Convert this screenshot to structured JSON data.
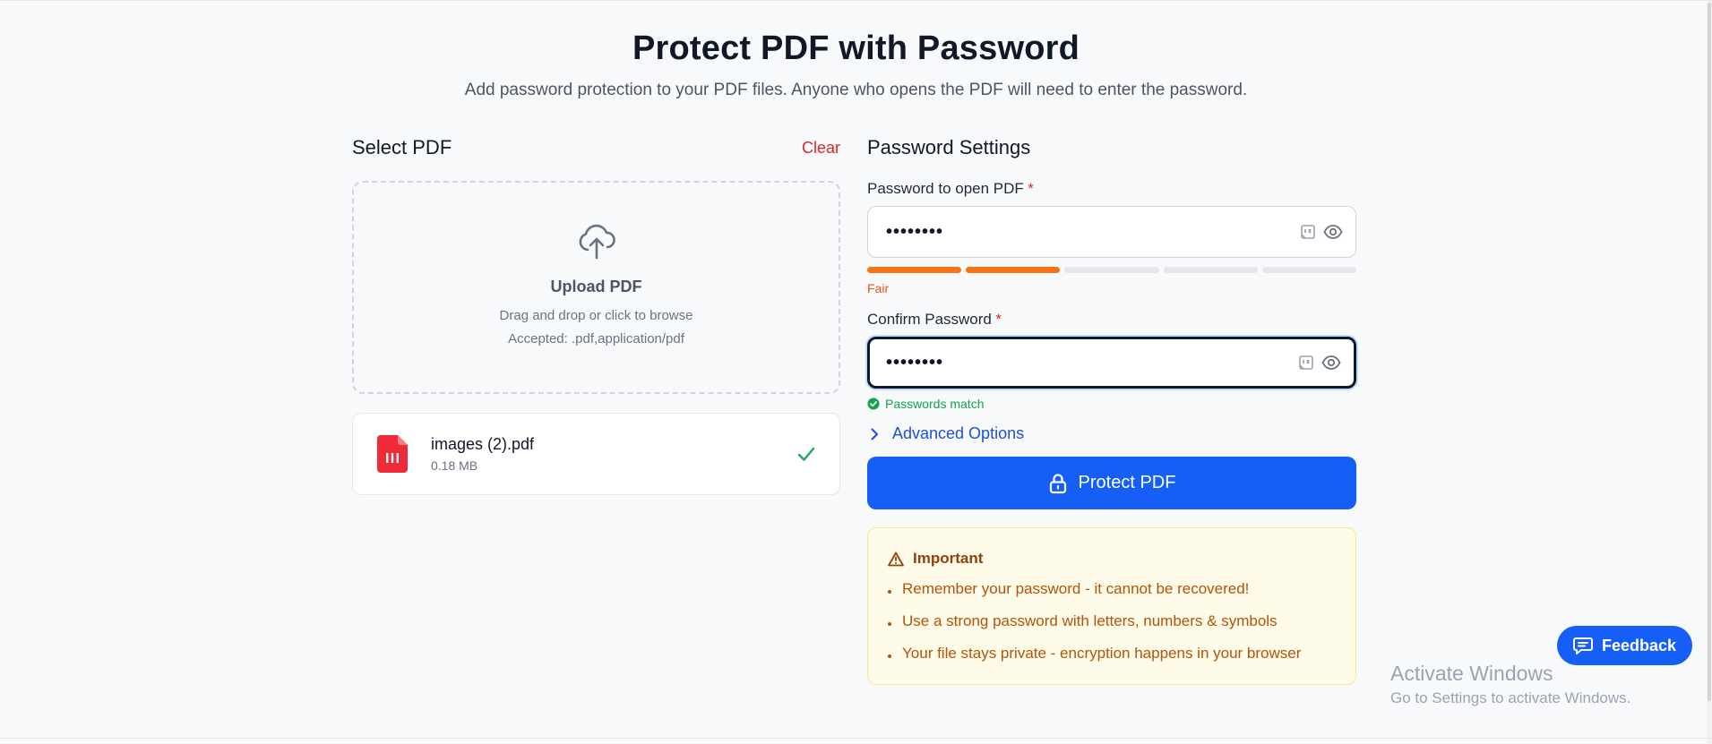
{
  "header": {
    "title": "Protect PDF with Password",
    "subtitle": "Add password protection to your PDF files. Anyone who opens the PDF will need to enter the password."
  },
  "upload": {
    "section_title": "Select PDF",
    "clear_label": "Clear",
    "icon": "cloud-upload-icon",
    "title": "Upload PDF",
    "hint": "Drag and drop or click to browse",
    "accepted": "Accepted: .pdf,application/pdf"
  },
  "file": {
    "name": "images (2).pdf",
    "size": "0.18 MB",
    "icon": "pdf-file-icon",
    "status_icon": "check-icon"
  },
  "password": {
    "section_title": "Password Settings",
    "open_label": "Password to open PDF",
    "required_mark": "*",
    "open_value": "••••••••",
    "strength_level": 2,
    "strength_segments": 5,
    "strength_label": "Fair",
    "confirm_label": "Confirm Password",
    "confirm_value": "••••••••",
    "match_text": "Passwords match"
  },
  "advanced": {
    "label": "Advanced Options"
  },
  "protect_button": {
    "label": "Protect PDF",
    "icon": "lock-icon"
  },
  "notice": {
    "title": "Important",
    "icon": "warning-icon",
    "items": [
      "Remember your password - it cannot be recovered!",
      "Use a strong password with letters, numbers & symbols",
      "Your file stays private - encryption happens in your browser"
    ]
  },
  "feedback": {
    "label": "Feedback"
  },
  "watermark": {
    "title": "Activate Windows",
    "subtitle": "Go to Settings to activate Windows."
  },
  "colors": {
    "accent": "#155ef6",
    "danger": "#dc2626",
    "strength": "#f97316",
    "success": "#16a34a",
    "warning_bg": "#fefbe8"
  }
}
